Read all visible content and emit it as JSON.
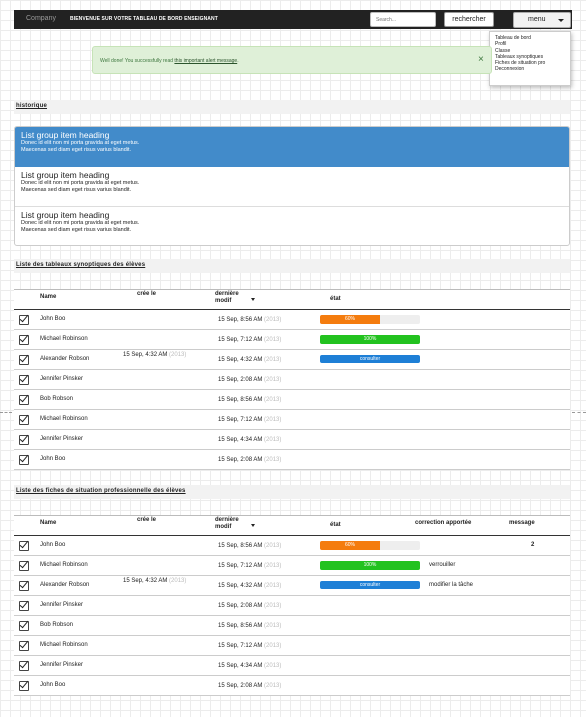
{
  "navbar": {
    "brand": "Company",
    "welcome": "BIENVENUE SUR VOTRE TABLEAU DE BORD ENSEIGNANT",
    "search_placeholder": "Search...",
    "search_button": "rechercher",
    "menu_button": "menu"
  },
  "menu_items": [
    "Tableau de bord",
    "Profil",
    "Classe",
    "Tableaux synoptiques",
    "Fiches de situation pro",
    "Deconnexion"
  ],
  "alert": {
    "prefix": "Well done! You successfully read ",
    "link": "this important alert message",
    "suffix": ".",
    "close": "×"
  },
  "historique": {
    "title": "historique",
    "items": [
      {
        "heading": "List group item heading",
        "line1": "Donec id elit non mi porta gravida at eget metus.",
        "line2": "Maecenas sed diam eget risus varius blandit.",
        "active": true
      },
      {
        "heading": "List group item heading",
        "line1": "Donec id elit non mi porta gravida at eget metus.",
        "line2": "Maecenas sed diam eget risus varius blandit.",
        "active": false
      },
      {
        "heading": "List group item heading",
        "line1": "Donec id elit non mi porta gravida at eget metus.",
        "line2": "Maecenas sed diam eget risus varius blandit.",
        "active": false
      }
    ]
  },
  "synoptiques": {
    "title": "Liste des tableaux synoptiques des élèves",
    "headers": {
      "name": "Name",
      "created": "crée le",
      "modified": "dernière modif",
      "state": "état"
    },
    "created_date": "15 Sep, 4:32 AM",
    "created_year": "(2013)",
    "rows": [
      {
        "name": "John Boo",
        "date": "15 Sep, 8:56 AM",
        "year": "(2013)",
        "progress": 60,
        "progress_label": "60%",
        "color": "#f47c0e"
      },
      {
        "name": "Michael Robinson",
        "date": "15 Sep, 7:12 AM",
        "year": "(2013)",
        "progress": 100,
        "progress_label": "100%",
        "color": "#22c21f"
      },
      {
        "name": "Alexander Robson",
        "date": "15 Sep, 4:32 AM",
        "year": "(2013)",
        "button": "consulter"
      },
      {
        "name": "Jennifer Pinsker",
        "date": "15 Sep, 2:08 AM",
        "year": "(2013)"
      },
      {
        "name": "Bob Robson",
        "date": "15 Sep, 8:56 AM",
        "year": "(2013)"
      },
      {
        "name": "Michael Robinson",
        "date": "15 Sep, 7:12 AM",
        "year": "(2013)"
      },
      {
        "name": "Jennifer Pinsker",
        "date": "15 Sep, 4:34 AM",
        "year": "(2013)"
      },
      {
        "name": "John Boo",
        "date": "15 Sep, 2:08 AM",
        "year": "(2013)"
      }
    ]
  },
  "fiches": {
    "title": "Liste des fiches de situation professionnelle des élèves",
    "headers": {
      "name": "Name",
      "created": "crée le",
      "modified": "dernière modif",
      "state": "état",
      "correction": "correction apportée",
      "message": "message"
    },
    "created_date": "15 Sep, 4:32 AM",
    "created_year": "(2013)",
    "rows": [
      {
        "name": "John Boo",
        "date": "15 Sep, 8:56 AM",
        "year": "(2013)",
        "progress": 60,
        "progress_label": "60%",
        "color": "#f47c0e",
        "message": "2"
      },
      {
        "name": "Michael Robinson",
        "date": "15 Sep, 7:12 AM",
        "year": "(2013)",
        "progress": 100,
        "progress_label": "100%",
        "color": "#22c21f",
        "correction": "verrouiller"
      },
      {
        "name": "Alexander Robson",
        "date": "15 Sep, 4:32 AM",
        "year": "(2013)",
        "button": "consulter",
        "correction": "modifier la tâche"
      },
      {
        "name": "Jennifer Pinsker",
        "date": "15 Sep, 2:08 AM",
        "year": "(2013)"
      },
      {
        "name": "Bob Robson",
        "date": "15 Sep, 8:56 AM",
        "year": "(2013)"
      },
      {
        "name": "Michael Robinson",
        "date": "15 Sep, 7:12 AM",
        "year": "(2013)"
      },
      {
        "name": "Jennifer Pinsker",
        "date": "15 Sep, 4:34 AM",
        "year": "(2013)"
      },
      {
        "name": "John Boo",
        "date": "15 Sep, 2:08 AM",
        "year": "(2013)"
      }
    ]
  }
}
